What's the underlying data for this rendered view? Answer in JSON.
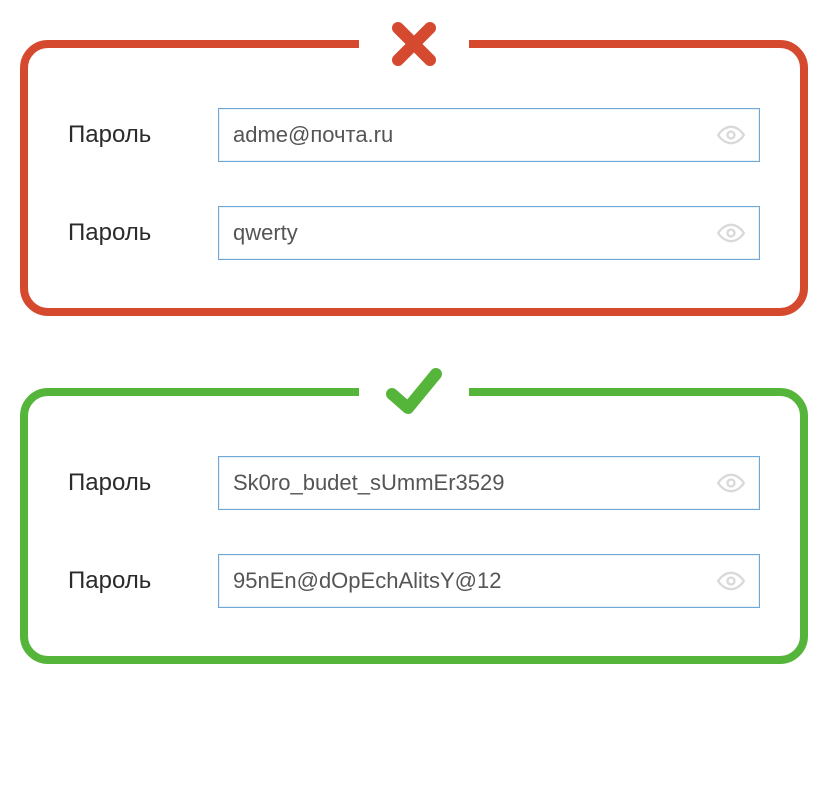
{
  "colors": {
    "bad": "#d5492f",
    "good": "#55b53a",
    "input_border": "#6fa8d6"
  },
  "bad": {
    "icon": "cross",
    "rows": [
      {
        "label": "Пароль",
        "value": "adme@почта.ru"
      },
      {
        "label": "Пароль",
        "value": "qwerty"
      }
    ]
  },
  "good": {
    "icon": "check",
    "rows": [
      {
        "label": "Пароль",
        "value": "Sk0ro_budet_sUmmEr3529"
      },
      {
        "label": "Пароль",
        "value": "95nEn@dOpEchAlitsY@12"
      }
    ]
  }
}
